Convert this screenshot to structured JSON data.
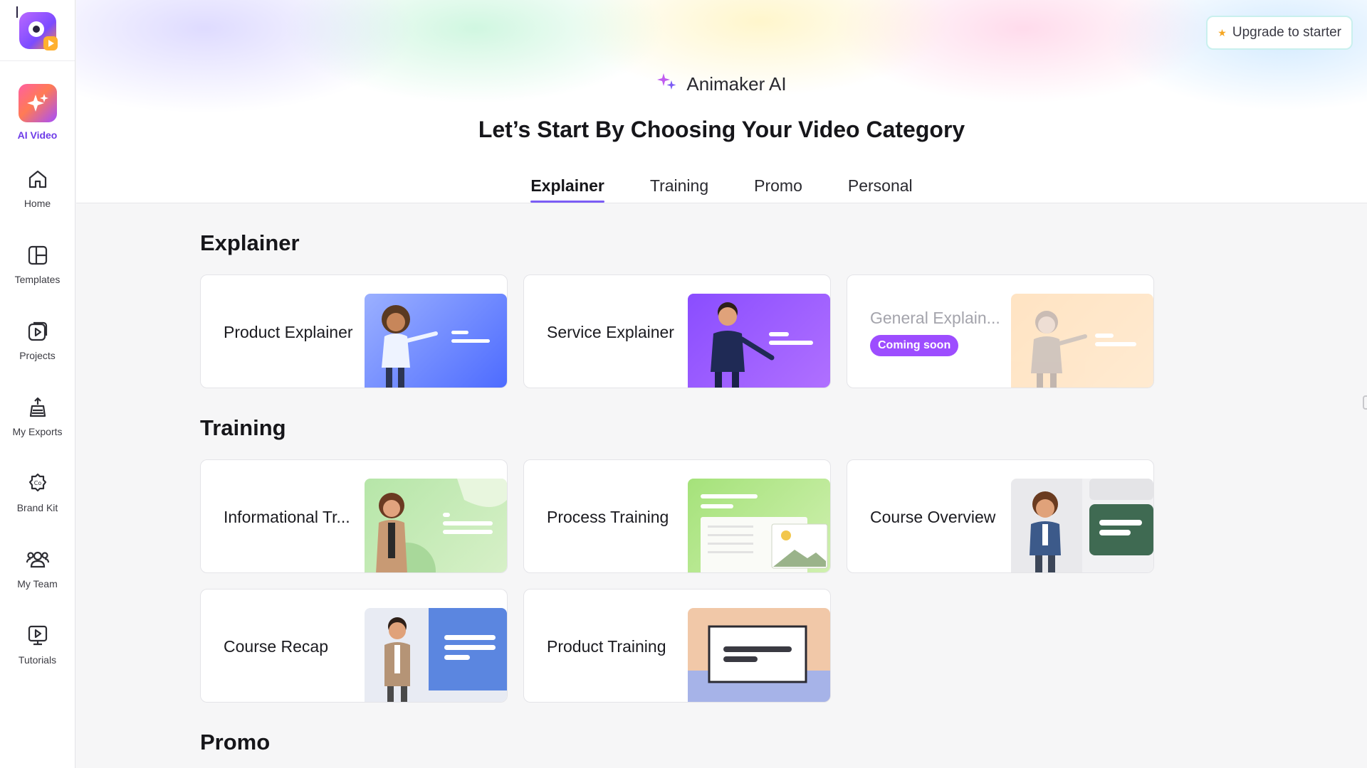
{
  "sidebar": {
    "items": [
      {
        "label": "AI Video",
        "icon": "ai-video-icon",
        "active": true
      },
      {
        "label": "Home",
        "icon": "home-icon"
      },
      {
        "label": "Templates",
        "icon": "templates-icon"
      },
      {
        "label": "Projects",
        "icon": "projects-icon"
      },
      {
        "label": "My Exports",
        "icon": "exports-icon"
      },
      {
        "label": "Brand Kit",
        "icon": "brand-kit-icon"
      },
      {
        "label": "My Team",
        "icon": "team-icon"
      },
      {
        "label": "Tutorials",
        "icon": "tutorials-icon"
      }
    ]
  },
  "header": {
    "upgrade_label": "Upgrade to starter",
    "brand": "Animaker AI",
    "title": "Let’s Start By Choosing Your Video Category",
    "tabs": [
      {
        "label": "Explainer",
        "active": true
      },
      {
        "label": "Training"
      },
      {
        "label": "Promo"
      },
      {
        "label": "Personal"
      }
    ]
  },
  "sections": {
    "explainer": {
      "title": "Explainer",
      "cards": [
        {
          "label": "Product Explainer"
        },
        {
          "label": "Service Explainer"
        },
        {
          "label": "General Explain...",
          "badge": "Coming soon"
        }
      ]
    },
    "training": {
      "title": "Training",
      "cards": [
        {
          "label": "Informational Tr..."
        },
        {
          "label": "Process Training"
        },
        {
          "label": "Course Overview"
        },
        {
          "label": "Course Recap"
        },
        {
          "label": "Product Training"
        }
      ]
    },
    "promo": {
      "title": "Promo"
    }
  },
  "colors": {
    "accent": "#7b5cf5",
    "badge": "#9d4dff",
    "active_nav": "#6d3ce8"
  }
}
